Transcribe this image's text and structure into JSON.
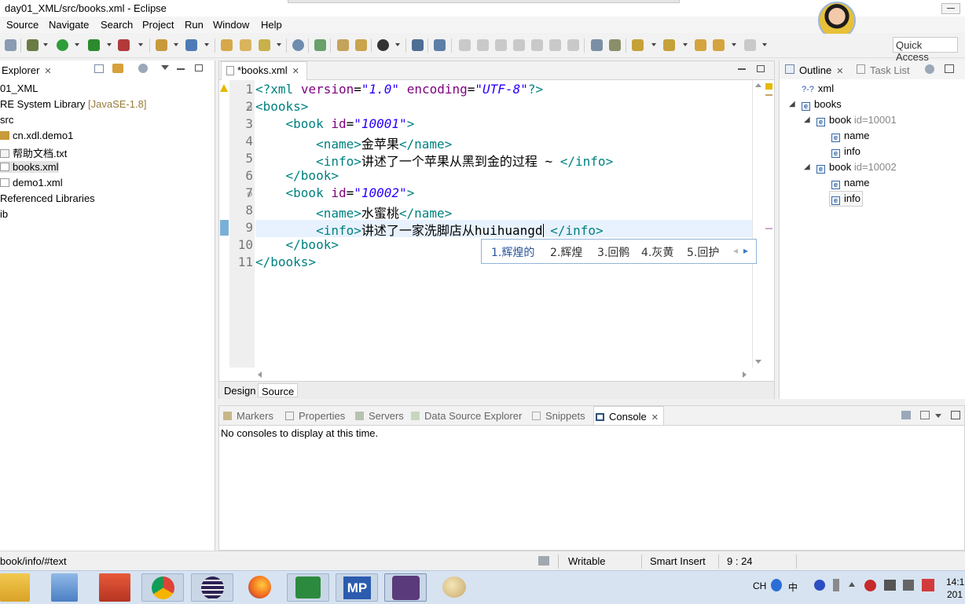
{
  "window": {
    "title": "day01_XML/src/books.xml - Eclipse"
  },
  "menu": [
    "Source",
    "Navigate",
    "Search",
    "Project",
    "Run",
    "Window",
    "Help"
  ],
  "toolbar": {
    "quick_access": "Quick Access"
  },
  "explorer": {
    "title": "Explorer",
    "items": [
      {
        "label": "01_XML"
      },
      {
        "label": "RE System Library",
        "suffix": "[JavaSE-1.8]"
      },
      {
        "label": "src"
      },
      {
        "label": "cn.xdl.demo1"
      },
      {
        "label": "帮助文档.txt"
      },
      {
        "label": "books.xml"
      },
      {
        "label": "demo1.xml"
      },
      {
        "label": "Referenced Libraries"
      },
      {
        "label": "ib"
      }
    ]
  },
  "editor": {
    "tab": "*books.xml",
    "line_numbers": [
      "1",
      "2",
      "3",
      "4",
      "5",
      "6",
      "7",
      "8",
      "9",
      "10",
      "11"
    ],
    "lines": [
      {
        "parts": [
          [
            "tagc",
            "<?"
          ],
          [
            "tagc",
            "xml"
          ],
          [
            "txt",
            " "
          ],
          [
            "attr",
            "version"
          ],
          [
            "txt",
            "="
          ],
          [
            "val",
            "\"1.0\""
          ],
          [
            "txt",
            " "
          ],
          [
            "attr",
            "encoding"
          ],
          [
            "txt",
            "="
          ],
          [
            "val",
            "\"UTF-8\""
          ],
          [
            "tagc",
            "?>"
          ]
        ]
      },
      {
        "parts": [
          [
            "tagc",
            "<books>"
          ]
        ]
      },
      {
        "parts": [
          [
            "txt",
            "    "
          ],
          [
            "tagc",
            "<book"
          ],
          [
            "txt",
            " "
          ],
          [
            "attr",
            "id"
          ],
          [
            "txt",
            "="
          ],
          [
            "val",
            "\"10001\""
          ],
          [
            "tagc",
            ">"
          ]
        ]
      },
      {
        "parts": [
          [
            "txt",
            "        "
          ],
          [
            "tagc",
            "<name>"
          ],
          [
            "txt",
            "金苹果"
          ],
          [
            "tagc",
            "</name>"
          ]
        ]
      },
      {
        "parts": [
          [
            "txt",
            "        "
          ],
          [
            "tagc",
            "<info>"
          ],
          [
            "txt",
            "讲述了一个苹果从黑到金的过程 ~ "
          ],
          [
            "tagc",
            "</info>"
          ]
        ]
      },
      {
        "parts": [
          [
            "txt",
            "    "
          ],
          [
            "tagc",
            "</book>"
          ]
        ]
      },
      {
        "parts": [
          [
            "txt",
            "    "
          ],
          [
            "tagc",
            "<book"
          ],
          [
            "txt",
            " "
          ],
          [
            "attr",
            "id"
          ],
          [
            "txt",
            "="
          ],
          [
            "val",
            "\"10002\""
          ],
          [
            "tagc",
            ">"
          ]
        ]
      },
      {
        "parts": [
          [
            "txt",
            "        "
          ],
          [
            "tagc",
            "<name>"
          ],
          [
            "txt",
            "水蜜桃"
          ],
          [
            "tagc",
            "</name>"
          ]
        ]
      },
      {
        "parts": [
          [
            "txt",
            "        "
          ],
          [
            "tagc",
            "<info>"
          ],
          [
            "txt",
            "讲述了一家洗脚店从huihuangd "
          ],
          [
            "tagc",
            "</info>"
          ]
        ]
      },
      {
        "parts": [
          [
            "txt",
            "    "
          ],
          [
            "tagc",
            "</book>"
          ]
        ]
      },
      {
        "parts": [
          [
            "tagc",
            "</books>"
          ]
        ]
      }
    ],
    "bottom_tabs": {
      "design": "Design",
      "source": "Source"
    },
    "content_assist": [
      "1.辉煌的",
      "2.辉煌",
      "3.回鹘",
      "4.灰黄",
      "5.回护"
    ]
  },
  "outline": {
    "tabs": {
      "outline": "Outline",
      "task_list": "Task List"
    },
    "nodes": [
      {
        "label": "xml",
        "icon": "?-?"
      },
      {
        "label": "books"
      },
      {
        "label": "book",
        "attr": "id=10001"
      },
      {
        "label": "name"
      },
      {
        "label": "info"
      },
      {
        "label": "book",
        "attr": "id=10002"
      },
      {
        "label": "name"
      },
      {
        "label": "info"
      }
    ]
  },
  "bottom_panel": {
    "tabs": [
      "Markers",
      "Properties",
      "Servers",
      "Data Source Explorer",
      "Snippets",
      "Console"
    ],
    "message": "No consoles to display at this time."
  },
  "status": {
    "path": "book/info/#text",
    "writable": "Writable",
    "insert_mode": "Smart Insert",
    "position": "9 : 24"
  },
  "taskbar": {
    "ime": "CH",
    "ime_mode": "中",
    "clock_top": "14:1",
    "clock_bottom": "201"
  },
  "colors": {
    "tag": "#008080",
    "attribute": "#7f007f",
    "value": "#2a00ff",
    "current_line": "#e8f2fe"
  }
}
